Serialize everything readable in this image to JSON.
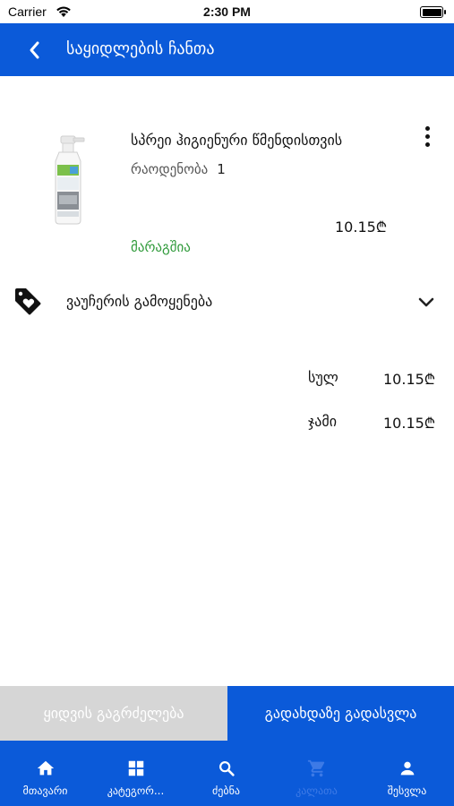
{
  "status_bar": {
    "carrier": "Carrier",
    "time": "2:30 PM",
    "battery_level": 1.0
  },
  "header": {
    "title": "საყიდლების ჩანთა",
    "back_icon": "chevron-left-icon"
  },
  "cart": {
    "items": [
      {
        "name": "სპრეი ჰიგიენური წმენდისთვის",
        "quantity_label": "რაოდენობა",
        "quantity": "1",
        "price": "10.15₾",
        "stock_status": "მარაგშია"
      }
    ]
  },
  "voucher": {
    "label": "ვაუჩერის გამოყენება",
    "icon": "tag-heart-icon"
  },
  "totals": {
    "subtotal_label": "სულ",
    "subtotal_value": "10.15₾",
    "total_label": "ჯამი",
    "total_value": "10.15₾"
  },
  "actions": {
    "continue_label": "ყიდვის გაგრძელება",
    "checkout_label": "გადახდაზე გადასვლა"
  },
  "tab_bar": {
    "tabs": [
      {
        "label": "მთავარი",
        "icon": "home-icon"
      },
      {
        "label": "კატეგორ...",
        "icon": "grid-icon"
      },
      {
        "label": "ძებნა",
        "icon": "search-icon"
      },
      {
        "label": "კალათა",
        "icon": "cart-icon"
      },
      {
        "label": "შესვლა",
        "icon": "person-icon"
      }
    ]
  },
  "colors": {
    "brand_blue": "#0b5ad9",
    "in_stock_green": "#2f9a3a",
    "secondary_button_gray": "#d6d6d6"
  }
}
